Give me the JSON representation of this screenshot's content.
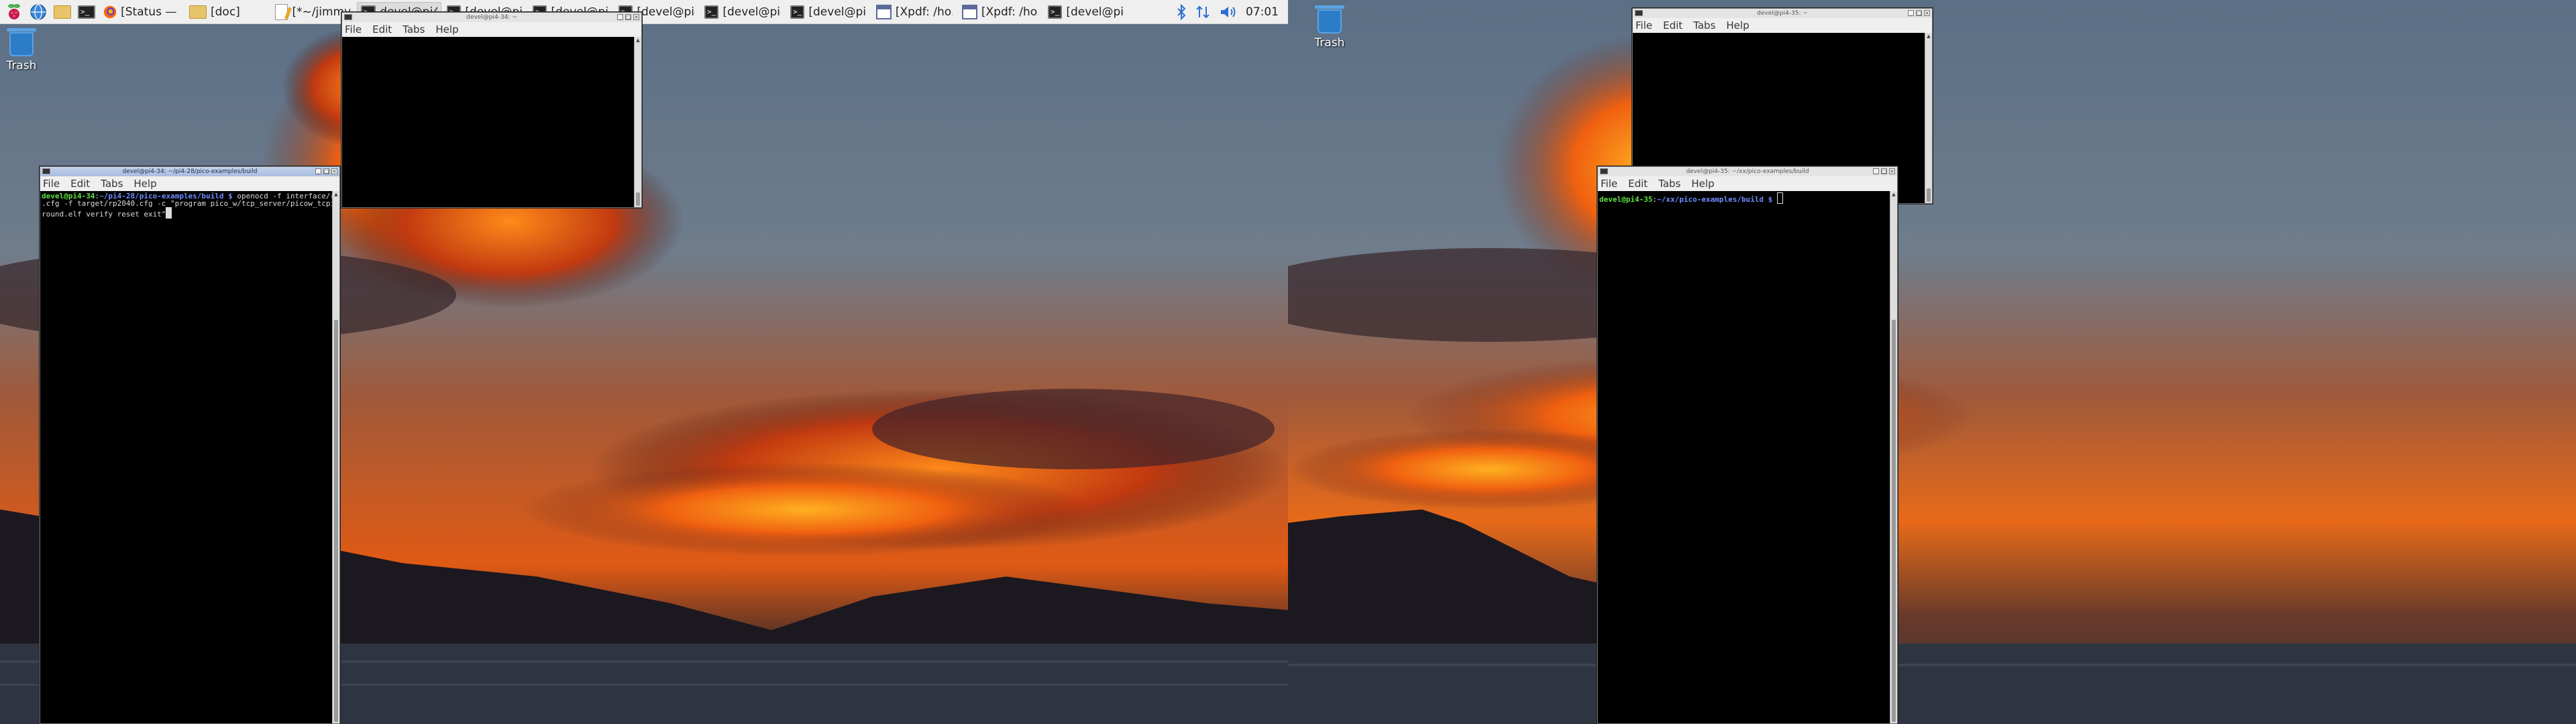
{
  "colors": {
    "panel_bg": "#efefef",
    "prompt_user": "#62e346",
    "prompt_path": "#6f8cff",
    "terminal_bg": "#000000",
    "titlebar_focused": "#a9bde0"
  },
  "taskbar": {
    "launchers": [
      {
        "name": "raspberry-menu",
        "icon": "raspberry-icon"
      },
      {
        "name": "web-browser",
        "icon": "globe-icon"
      },
      {
        "name": "file-manager",
        "icon": "folder-icon"
      },
      {
        "name": "terminal",
        "icon": "terminal-icon"
      }
    ],
    "tasks": [
      {
        "label": "[Status — ...",
        "icon": "firefox-icon"
      },
      {
        "label": "[doc]",
        "icon": "folder-icon"
      },
      {
        "label": "[*~/jimmy...",
        "icon": "text-editor-icon"
      },
      {
        "label": "devel@pi4...",
        "icon": "terminal-icon"
      },
      {
        "label": "[devel@pi4...",
        "icon": "terminal-icon"
      },
      {
        "label": "[devel@pi4...",
        "icon": "terminal-icon"
      },
      {
        "label": "[devel@pi4...",
        "icon": "terminal-icon"
      },
      {
        "label": "[devel@pi4...",
        "icon": "terminal-icon"
      },
      {
        "label": "[devel@pi4...",
        "icon": "terminal-icon"
      },
      {
        "label": "[Xpdf: /ho...",
        "icon": "pdf-icon"
      },
      {
        "label": "[Xpdf: /ho...",
        "icon": "pdf-icon"
      },
      {
        "label": "[devel@pi4...",
        "icon": "terminal-icon"
      }
    ],
    "tray": {
      "bluetooth": "bluetooth-icon",
      "network": "network-arrows-icon",
      "volume": "volume-icon",
      "clock": "07:01"
    }
  },
  "desktop": {
    "left_trash_label": "Trash",
    "right_trash_label": "Trash"
  },
  "windows": {
    "term_top_left": {
      "title": "devel@pi4-34: ~",
      "menu": [
        "File",
        "Edit",
        "Tabs",
        "Help"
      ]
    },
    "term_bottom_left": {
      "title": "devel@pi4-34: ~/pi4-28/pico-examples/build",
      "menu": [
        "File",
        "Edit",
        "Tabs",
        "Help"
      ],
      "prompt_user": "devel@pi4-34",
      "prompt_sep": ":",
      "prompt_path": "~/pi4-28/pico-examples/build",
      "prompt_end": " $ ",
      "command_line1": "openocd -f interface/raspberrypi-swd",
      "command_line2": ".cfg -f target/rp2040.cfg -c \"program pico_w/tcp_server/picow_tcpip_server_backg",
      "command_line3": "round.elf verify reset exit\""
    },
    "term_top_right": {
      "title": "devel@pi4-35: ~",
      "menu": [
        "File",
        "Edit",
        "Tabs",
        "Help"
      ]
    },
    "term_bottom_right": {
      "title": "devel@pi4-35: ~/xx/pico-examples/build",
      "menu": [
        "File",
        "Edit",
        "Tabs",
        "Help"
      ],
      "prompt_user": "devel@pi4-35",
      "prompt_sep": ":",
      "prompt_path": "~/xx/pico-examples/build",
      "prompt_end": " $ "
    }
  }
}
